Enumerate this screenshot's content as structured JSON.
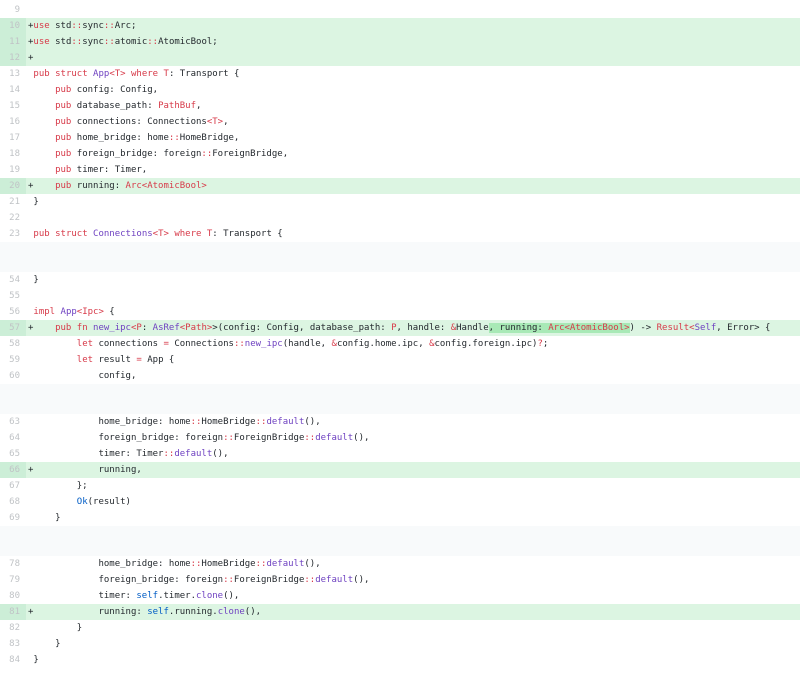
{
  "app": {
    "view": "code-diff",
    "language": "rust"
  },
  "colors": {
    "keyword": "#d73a49",
    "entity": "#6f42c1",
    "constant": "#005cc5",
    "text": "#24292e",
    "line_number": "#c0c3c6",
    "added_row_bg": "#dcf5e2",
    "added_gutter_bg": "#cceed7",
    "word_highlight_bg": "#a8e9b6",
    "gap_bg": "#f8fafb",
    "page_bg": "#ffffff"
  },
  "diff": {
    "lines": [
      {
        "num": "9",
        "type": "context",
        "segments": []
      },
      {
        "num": "10",
        "type": "added",
        "segments": [
          [
            "pl",
            "+"
          ],
          [
            "k",
            "use"
          ],
          [
            "pl",
            " std"
          ],
          [
            "k",
            "::"
          ],
          [
            "pl",
            "sync"
          ],
          [
            "k",
            "::"
          ],
          [
            "pl",
            "Arc;"
          ]
        ]
      },
      {
        "num": "11",
        "type": "added",
        "segments": [
          [
            "pl",
            "+"
          ],
          [
            "k",
            "use"
          ],
          [
            "pl",
            " std"
          ],
          [
            "k",
            "::"
          ],
          [
            "pl",
            "sync"
          ],
          [
            "k",
            "::"
          ],
          [
            "pl",
            "atomic"
          ],
          [
            "k",
            "::"
          ],
          [
            "pl",
            "AtomicBool;"
          ]
        ]
      },
      {
        "num": "12",
        "type": "added",
        "segments": [
          [
            "pl",
            "+"
          ]
        ]
      },
      {
        "num": "13",
        "type": "context",
        "segments": [
          [
            "pl",
            " "
          ],
          [
            "k",
            "pub"
          ],
          [
            "pl",
            " "
          ],
          [
            "k",
            "struct"
          ],
          [
            "pl",
            " "
          ],
          [
            "en",
            "App"
          ],
          [
            "k",
            "<T>"
          ],
          [
            "pl",
            " "
          ],
          [
            "k",
            "where"
          ],
          [
            "pl",
            " "
          ],
          [
            "k",
            "T"
          ],
          [
            "pl",
            ": Transport {"
          ]
        ]
      },
      {
        "num": "14",
        "type": "context",
        "segments": [
          [
            "pl",
            "     "
          ],
          [
            "k",
            "pub"
          ],
          [
            "pl",
            " config: Config,"
          ]
        ]
      },
      {
        "num": "15",
        "type": "context",
        "segments": [
          [
            "pl",
            "     "
          ],
          [
            "k",
            "pub"
          ],
          [
            "pl",
            " database_path: "
          ],
          [
            "k",
            "PathBuf"
          ],
          [
            "pl",
            ","
          ]
        ]
      },
      {
        "num": "16",
        "type": "context",
        "segments": [
          [
            "pl",
            "     "
          ],
          [
            "k",
            "pub"
          ],
          [
            "pl",
            " connections: Connections"
          ],
          [
            "k",
            "<T>"
          ],
          [
            "pl",
            ","
          ]
        ]
      },
      {
        "num": "17",
        "type": "context",
        "segments": [
          [
            "pl",
            "     "
          ],
          [
            "k",
            "pub"
          ],
          [
            "pl",
            " home_bridge: home"
          ],
          [
            "k",
            "::"
          ],
          [
            "pl",
            "HomeBridge,"
          ]
        ]
      },
      {
        "num": "18",
        "type": "context",
        "segments": [
          [
            "pl",
            "     "
          ],
          [
            "k",
            "pub"
          ],
          [
            "pl",
            " foreign_bridge: foreign"
          ],
          [
            "k",
            "::"
          ],
          [
            "pl",
            "ForeignBridge,"
          ]
        ]
      },
      {
        "num": "19",
        "type": "context",
        "segments": [
          [
            "pl",
            "     "
          ],
          [
            "k",
            "pub"
          ],
          [
            "pl",
            " timer: Timer,"
          ]
        ]
      },
      {
        "num": "20",
        "type": "added",
        "segments": [
          [
            "pl",
            "+    "
          ],
          [
            "k",
            "pub"
          ],
          [
            "pl",
            " running: "
          ],
          [
            "k",
            "Arc<AtomicBool>"
          ]
        ]
      },
      {
        "num": "21",
        "type": "context",
        "segments": [
          [
            "pl",
            " }"
          ]
        ]
      },
      {
        "num": "22",
        "type": "context",
        "segments": []
      },
      {
        "num": "23",
        "type": "context",
        "segments": [
          [
            "pl",
            " "
          ],
          [
            "k",
            "pub"
          ],
          [
            "pl",
            " "
          ],
          [
            "k",
            "struct"
          ],
          [
            "pl",
            " "
          ],
          [
            "en",
            "Connections"
          ],
          [
            "k",
            "<T>"
          ],
          [
            "pl",
            " "
          ],
          [
            "k",
            "where"
          ],
          [
            "pl",
            " "
          ],
          [
            "k",
            "T"
          ],
          [
            "pl",
            ": Transport {"
          ]
        ]
      },
      {
        "type": "gap"
      },
      {
        "num": "54",
        "type": "context",
        "segments": [
          [
            "pl",
            " }"
          ]
        ]
      },
      {
        "num": "55",
        "type": "context",
        "segments": []
      },
      {
        "num": "56",
        "type": "context",
        "segments": [
          [
            "pl",
            " "
          ],
          [
            "k",
            "impl"
          ],
          [
            "pl",
            " "
          ],
          [
            "en",
            "App"
          ],
          [
            "k",
            "<Ipc>"
          ],
          [
            "pl",
            " {"
          ]
        ]
      },
      {
        "num": "57",
        "type": "added",
        "segments": [
          [
            "pl",
            "+    "
          ],
          [
            "k",
            "pub"
          ],
          [
            "pl",
            " "
          ],
          [
            "k",
            "fn"
          ],
          [
            "pl",
            " "
          ],
          [
            "en",
            "new_ipc"
          ],
          [
            "k",
            "<P"
          ],
          [
            "pl",
            ": "
          ],
          [
            "en",
            "AsRef"
          ],
          [
            "k",
            "<Path>"
          ],
          [
            "pl",
            ">(config: Config, database_path: "
          ],
          [
            "k",
            "P"
          ],
          [
            "pl",
            ", handle: "
          ],
          [
            "k",
            "&"
          ],
          [
            "pl",
            "Handle"
          ],
          [
            "pl",
            ", running: ",
            "hl"
          ],
          [
            "k",
            "Arc<AtomicBool>",
            "hl"
          ],
          [
            "pl",
            ") -> "
          ],
          [
            "k",
            "Result<"
          ],
          [
            "en",
            "Self"
          ],
          [
            "pl",
            ", Error> {"
          ]
        ]
      },
      {
        "num": "58",
        "type": "context",
        "segments": [
          [
            "pl",
            "         "
          ],
          [
            "k",
            "let"
          ],
          [
            "pl",
            " connections "
          ],
          [
            "k",
            "="
          ],
          [
            "pl",
            " Connections"
          ],
          [
            "k",
            "::"
          ],
          [
            "en",
            "new_ipc"
          ],
          [
            "pl",
            "(handle, "
          ],
          [
            "k",
            "&"
          ],
          [
            "pl",
            "config.home.ipc, "
          ],
          [
            "k",
            "&"
          ],
          [
            "pl",
            "config.foreign.ipc)"
          ],
          [
            "k",
            "?"
          ],
          [
            "pl",
            ";"
          ]
        ]
      },
      {
        "num": "59",
        "type": "context",
        "segments": [
          [
            "pl",
            "         "
          ],
          [
            "k",
            "let"
          ],
          [
            "pl",
            " result "
          ],
          [
            "k",
            "="
          ],
          [
            "pl",
            " App {"
          ]
        ]
      },
      {
        "num": "60",
        "type": "context",
        "segments": [
          [
            "pl",
            "             config,"
          ]
        ]
      },
      {
        "type": "gap"
      },
      {
        "num": "63",
        "type": "context",
        "segments": [
          [
            "pl",
            "             home_bridge: home"
          ],
          [
            "k",
            "::"
          ],
          [
            "pl",
            "HomeBridge"
          ],
          [
            "k",
            "::"
          ],
          [
            "en",
            "default"
          ],
          [
            "pl",
            "(),"
          ]
        ]
      },
      {
        "num": "64",
        "type": "context",
        "segments": [
          [
            "pl",
            "             foreign_bridge: foreign"
          ],
          [
            "k",
            "::"
          ],
          [
            "pl",
            "ForeignBridge"
          ],
          [
            "k",
            "::"
          ],
          [
            "en",
            "default"
          ],
          [
            "pl",
            "(),"
          ]
        ]
      },
      {
        "num": "65",
        "type": "context",
        "segments": [
          [
            "pl",
            "             timer: Timer"
          ],
          [
            "k",
            "::"
          ],
          [
            "en",
            "default"
          ],
          [
            "pl",
            "(),"
          ]
        ]
      },
      {
        "num": "66",
        "type": "added",
        "segments": [
          [
            "pl",
            "+            running,"
          ]
        ]
      },
      {
        "num": "67",
        "type": "context",
        "segments": [
          [
            "pl",
            "         };"
          ]
        ]
      },
      {
        "num": "68",
        "type": "context",
        "segments": [
          [
            "pl",
            "         "
          ],
          [
            "c1",
            "Ok"
          ],
          [
            "pl",
            "(result)"
          ]
        ]
      },
      {
        "num": "69",
        "type": "context",
        "segments": [
          [
            "pl",
            "     }"
          ]
        ]
      },
      {
        "type": "gap"
      },
      {
        "num": "78",
        "type": "context",
        "segments": [
          [
            "pl",
            "             home_bridge: home"
          ],
          [
            "k",
            "::"
          ],
          [
            "pl",
            "HomeBridge"
          ],
          [
            "k",
            "::"
          ],
          [
            "en",
            "default"
          ],
          [
            "pl",
            "(),"
          ]
        ]
      },
      {
        "num": "79",
        "type": "context",
        "segments": [
          [
            "pl",
            "             foreign_bridge: foreign"
          ],
          [
            "k",
            "::"
          ],
          [
            "pl",
            "ForeignBridge"
          ],
          [
            "k",
            "::"
          ],
          [
            "en",
            "default"
          ],
          [
            "pl",
            "(),"
          ]
        ]
      },
      {
        "num": "80",
        "type": "context",
        "segments": [
          [
            "pl",
            "             timer: "
          ],
          [
            "c1",
            "self"
          ],
          [
            "pl",
            ".timer."
          ],
          [
            "en",
            "clone"
          ],
          [
            "pl",
            "(),"
          ]
        ]
      },
      {
        "num": "81",
        "type": "added",
        "segments": [
          [
            "pl",
            "+            running: "
          ],
          [
            "c1",
            "self"
          ],
          [
            "pl",
            ".running."
          ],
          [
            "en",
            "clone"
          ],
          [
            "pl",
            "(),"
          ]
        ]
      },
      {
        "num": "82",
        "type": "context",
        "segments": [
          [
            "pl",
            "         }"
          ]
        ]
      },
      {
        "num": "83",
        "type": "context",
        "segments": [
          [
            "pl",
            "     }"
          ]
        ]
      },
      {
        "num": "84",
        "type": "context",
        "segments": [
          [
            "pl",
            " }"
          ]
        ]
      }
    ]
  }
}
